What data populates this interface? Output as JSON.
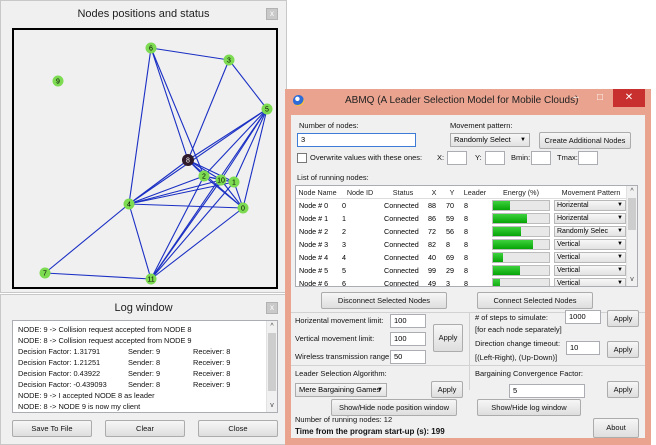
{
  "nodes_panel": {
    "title": "Nodes positions and status",
    "close_glyph": "x",
    "nodes": [
      {
        "label": "0"
      },
      {
        "label": "1"
      },
      {
        "label": "2"
      },
      {
        "label": "3"
      },
      {
        "label": "4"
      },
      {
        "label": "5"
      },
      {
        "label": "6"
      },
      {
        "label": "7"
      },
      {
        "label": "8",
        "leader": true
      },
      {
        "label": "9"
      },
      {
        "label": "10"
      },
      {
        "label": "11"
      }
    ],
    "colors": {
      "node": "#7ddb52",
      "leader": "#2e1a2a",
      "edge": "#1a2fc4"
    }
  },
  "log_panel": {
    "title": "Log window",
    "close_glyph": "x",
    "lines": [
      {
        "text": "NODE: 9 -> Collision request accepted from NODE 8"
      },
      {
        "text": "NODE: 8 -> Collision request accepted from NODE 9"
      },
      {
        "text": "Decision Factor: 1.31791",
        "c2": "Sender: 9",
        "c3": "Receiver: 8"
      },
      {
        "text": "Decision Factor: 1.21251",
        "c2": "Sender: 8",
        "c3": "Receiver: 9"
      },
      {
        "text": "Decision Factor: 0.43922",
        "c2": "Sender: 9",
        "c3": "Receiver: 8"
      },
      {
        "text": "Decision Factor: -0.439093",
        "c2": "Sender: 8",
        "c3": "Receiver: 9"
      },
      {
        "text": "NODE: 9 -> I accepted NODE 8 as leader"
      },
      {
        "text": "NODE: 8 -> NODE 9 is now my client"
      }
    ],
    "buttons": {
      "save": "Save To File",
      "clear": "Clear",
      "close": "Close"
    },
    "scroll_up": "^",
    "scroll_down": "v"
  },
  "abmq": {
    "title": "ABMQ (A Leader Selection Model for Mobile Clouds)",
    "controls": {
      "minimize": "–",
      "maximize": "□",
      "close": "✕"
    },
    "number_of_nodes_label": "Number of nodes:",
    "number_of_nodes_value": "3",
    "movement_pattern_label": "Movement pattern:",
    "movement_pattern_value": "Randomly Select",
    "create_button": "Create Additional Nodes",
    "overwrite_label": "Overwrite values with these ones:",
    "x_label": "X:",
    "y_label": "Y:",
    "bmin_label": "Bmin:",
    "tmax_label": "Tmax:",
    "list_label": "List of running nodes:",
    "columns": [
      "Node Name",
      "Node ID",
      "Status",
      "X",
      "Y",
      "Leader",
      "Energy (%)",
      "Movement Pattern"
    ],
    "rows": [
      {
        "name": "Node # 0",
        "id": "0",
        "status": "Connected",
        "x": "88",
        "y": "70",
        "leader": "8",
        "energy": 30,
        "pattern": "Horizental"
      },
      {
        "name": "Node # 1",
        "id": "1",
        "status": "Connected",
        "x": "86",
        "y": "59",
        "leader": "8",
        "energy": 60,
        "pattern": "Horizental"
      },
      {
        "name": "Node # 2",
        "id": "2",
        "status": "Connected",
        "x": "72",
        "y": "56",
        "leader": "8",
        "energy": 50,
        "pattern": "Randomly Selec"
      },
      {
        "name": "Node # 3",
        "id": "3",
        "status": "Connected",
        "x": "82",
        "y": "8",
        "leader": "8",
        "energy": 72,
        "pattern": "Vertical"
      },
      {
        "name": "Node # 4",
        "id": "4",
        "status": "Connected",
        "x": "40",
        "y": "69",
        "leader": "8",
        "energy": 18,
        "pattern": "Vertical"
      },
      {
        "name": "Node # 5",
        "id": "5",
        "status": "Connected",
        "x": "99",
        "y": "29",
        "leader": "8",
        "energy": 48,
        "pattern": "Vertical"
      },
      {
        "name": "Node # 6",
        "id": "6",
        "status": "Connected",
        "x": "49",
        "y": "3",
        "leader": "8",
        "energy": 12,
        "pattern": "Vertical"
      }
    ],
    "disconnect_button": "Disconnect Selected Nodes",
    "connect_button": "Connect Selected Nodes",
    "hlimit_label": "Horizental movement limit:",
    "hlimit_value": "100",
    "vlimit_label": "Vertical movement limit:",
    "vlimit_value": "100",
    "range_label": "Wireless transmission range:",
    "range_value": "50",
    "apply_label": "Apply",
    "steps_label": "# of steps to simulate:",
    "steps_value": "1000",
    "steps_note": "[for each node separately]",
    "dir_label": "Direction change timeout:",
    "dir_value": "10",
    "dir_note": "[(Left-Right), (Up-Down)]",
    "algo_label": "Leader Selection Algorithm:",
    "algo_value": "Mere Bargaining Games",
    "bcf_label": "Bargaining Convergence Factor:",
    "bcf_value": "5",
    "showhide_node_button": "Show/Hide node position window",
    "showhide_log_button": "Show/Hide log window",
    "running_label": "Number of running nodes: 12",
    "time_label": "Time from the program start-up (s): 199",
    "about_button": "About",
    "colors": {
      "energy": "#13b113",
      "frame": "#e9a38f",
      "close": "#c7302f"
    }
  }
}
